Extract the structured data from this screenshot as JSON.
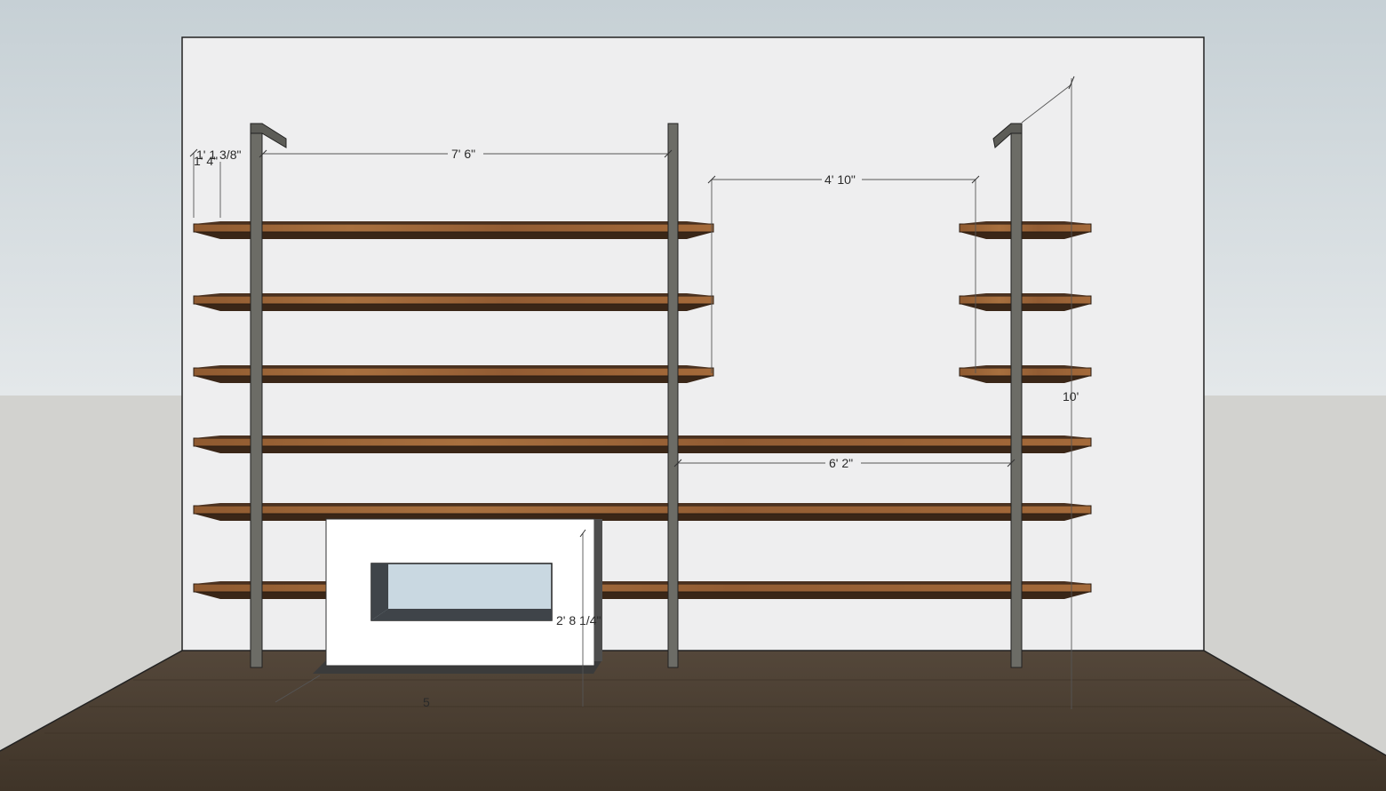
{
  "dimensions": {
    "shelf_span_left": "7' 6\"",
    "gap_upper": "4' 10\"",
    "shelf_span_right": "6' 2\"",
    "top_offset_a": "1' 1 3/8\"",
    "top_offset_b": "1' 4\"",
    "wall_height": "10'",
    "fireplace_height": "2' 8 1/4\"",
    "fireplace_depth": "5"
  },
  "colors": {
    "sky": "#c9d2d6",
    "wall": "#eeeeef",
    "side_wall": "#d3d3d1",
    "floor": "#4a3e31",
    "wood_front": "#9a6235",
    "wood_top": "#4a3120",
    "post": "#6c6c66",
    "fireplace": "#ffffff",
    "glass": "#c9d8e1"
  }
}
